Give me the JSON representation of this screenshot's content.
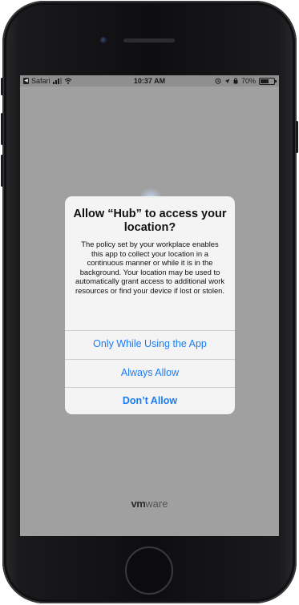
{
  "status_bar": {
    "back_app": "Safari",
    "time": "10:37 AM",
    "battery_percent": "70%",
    "battery_level": 0.7,
    "icons": [
      "signal-icon",
      "wifi-icon",
      "location-arrow-icon",
      "alarm-icon"
    ]
  },
  "dialog": {
    "title": "Allow “Hub” to access your location?",
    "message": "The policy set by your workplace enables this app to collect your location in a continuous manner or while it is in the background. Your location may be used to automatically grant access to additional work resources or find your device if lost or stolen.",
    "buttons": [
      {
        "label": "Only While Using the App"
      },
      {
        "label": "Always Allow"
      },
      {
        "label": "Don’t Allow"
      }
    ]
  },
  "logo": {
    "brand_bold": "vm",
    "brand_rest": "ware"
  },
  "colors": {
    "accent": "#1a7cf5",
    "dimmed_background": "#a0a0a0",
    "dialog_background": "#f4f4f4"
  }
}
